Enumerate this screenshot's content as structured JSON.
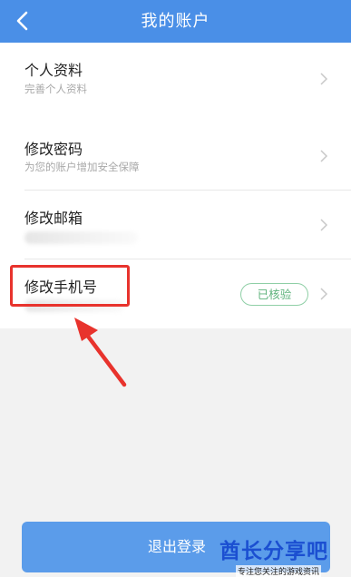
{
  "header": {
    "title": "我的账户",
    "back_icon": "chevron-left-icon",
    "color": "#4a8fe7"
  },
  "rows": [
    {
      "title": "个人资料",
      "subtitle": "完善个人资料"
    },
    {
      "title": "修改密码",
      "subtitle": "为您的账户增加安全保障"
    },
    {
      "title": "修改邮箱",
      "subtitle": ""
    },
    {
      "title": "修改手机号",
      "subtitle": "",
      "badge": "已核验",
      "badge_color": "#5cb27a"
    }
  ],
  "footer": {
    "logout_label": "退出登录",
    "button_color": "#5b9cea"
  },
  "watermark": {
    "title": "酋长分享吧",
    "subtitle": "专注您关注的游戏资讯"
  },
  "annotation": {
    "highlight_color": "#e8332d"
  }
}
